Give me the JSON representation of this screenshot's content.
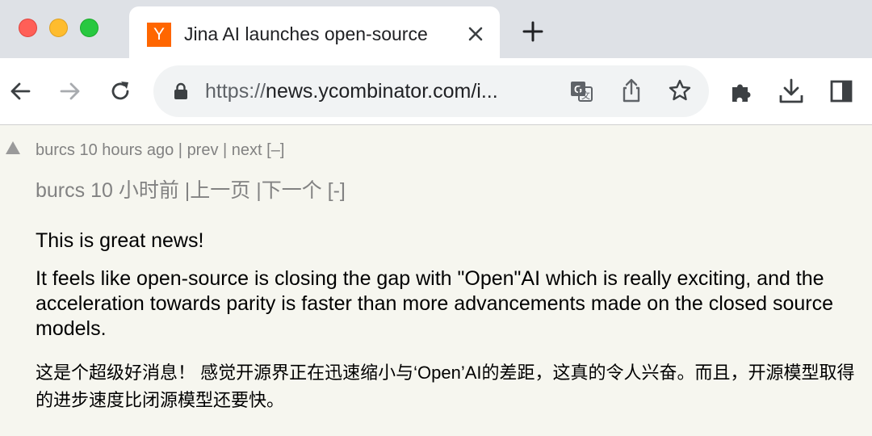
{
  "browser": {
    "tab": {
      "favicon_text": "Y",
      "title": "Jina AI launches open-source",
      "favicon_color": "#ff6600"
    },
    "url": {
      "protocol": "https://",
      "rest": "news.ycombinator.com/i..."
    },
    "icons": {
      "back": "back-arrow-icon",
      "forward": "forward-arrow-icon",
      "reload": "reload-icon",
      "lock": "lock-icon",
      "translate": "translate-icon",
      "share": "share-icon",
      "bookmark": "star-icon",
      "extensions": "puzzle-icon",
      "download": "download-icon",
      "sidepanel": "side-panel-icon"
    }
  },
  "comment": {
    "user": "burcs",
    "age": "10 hours ago",
    "prev": "prev",
    "next": "next",
    "toggle": "[–]",
    "meta_translated": "burcs 10 小时前 |上一页 |下一个 [-]",
    "paragraphs": [
      "This is great news!",
      "It feels like open-source is closing the gap with \"Open\"AI which is really exciting, and the acceleration towards parity is faster than more advancements made on the closed source models.",
      "这是个超级好消息！ 感觉开源界正在迅速缩小与‘Open’AI的差距，这真的令人兴奋。而且，开源模型取得的进步速度比闭源模型还要快。"
    ]
  },
  "colors": {
    "page_bg": "#f6f6ef",
    "meta_text": "#828282"
  }
}
